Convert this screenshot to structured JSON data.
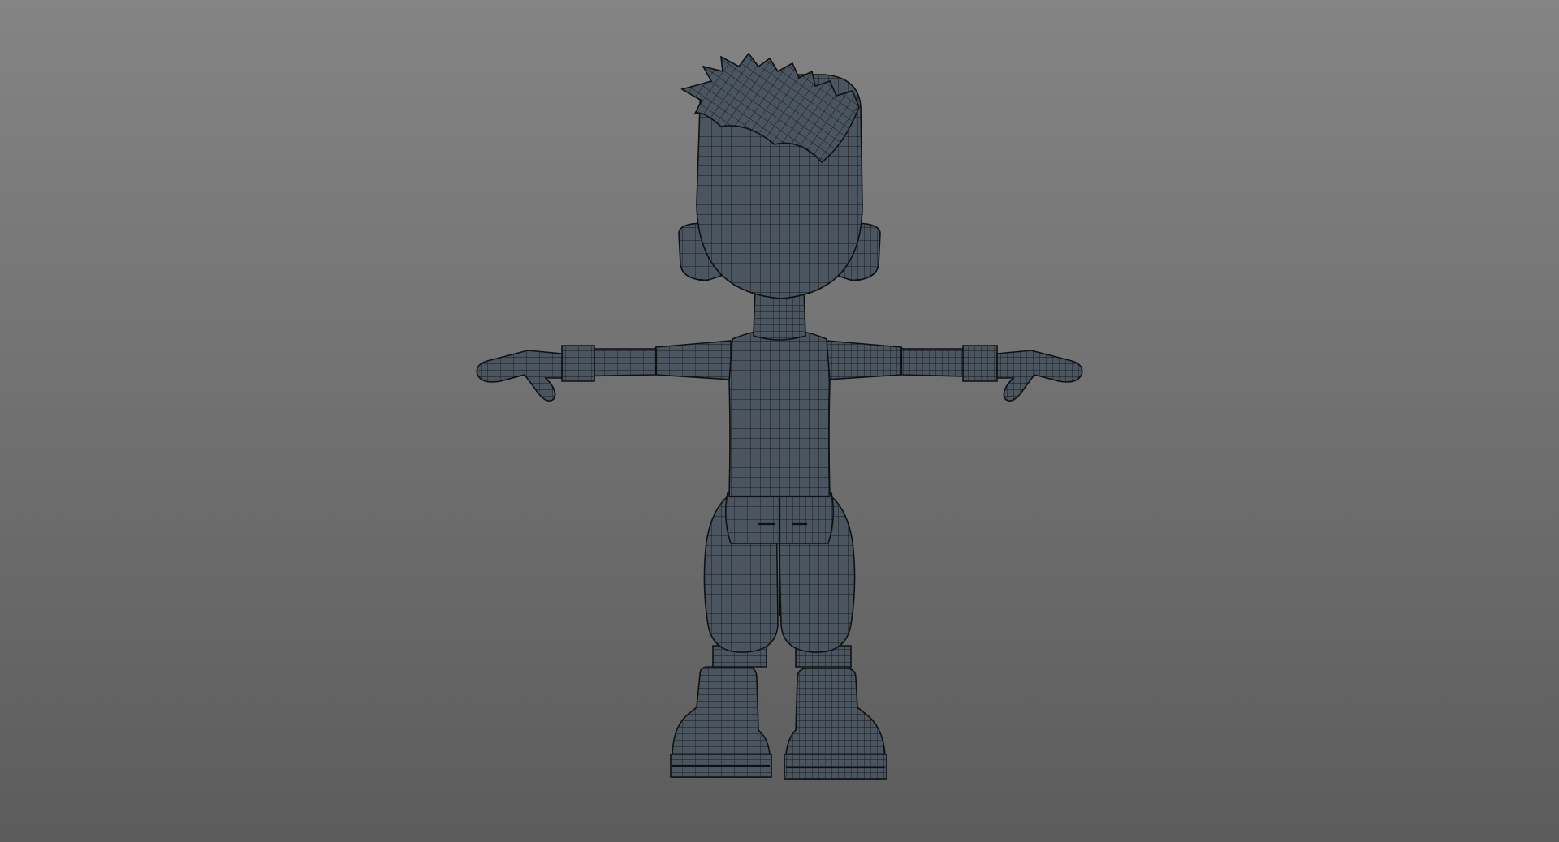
{
  "viewport": {
    "background_top": "#848484",
    "background_bottom": "#5c5c5c"
  },
  "model": {
    "pose": "T-pose",
    "view": "back",
    "display": "wireframe-on-shaded",
    "surface_color": "#4b5560",
    "wire_color": "#15191d",
    "outline_color": "#0e1114"
  }
}
